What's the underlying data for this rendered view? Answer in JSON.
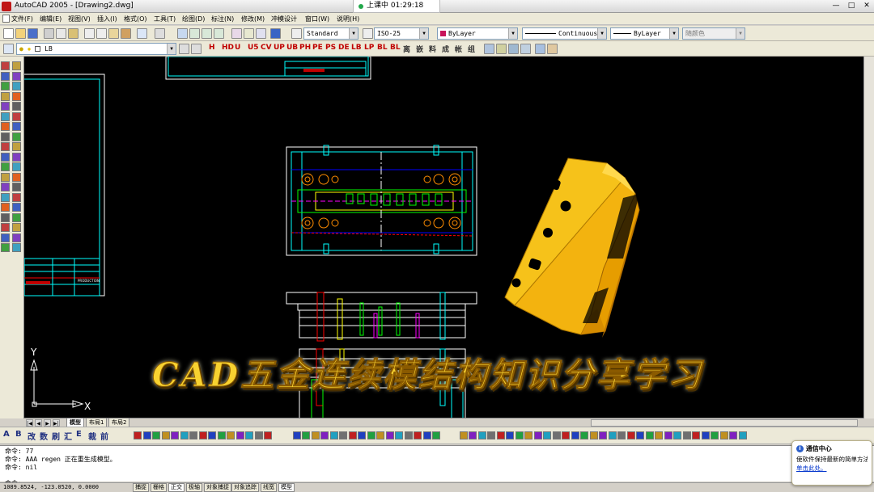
{
  "window": {
    "title": "AutoCAD 2005 - [Drawing2.dwg]",
    "meeting_status": "上课中 01:29:18",
    "min_label": "—",
    "max_label": "□",
    "close_label": "✕"
  },
  "menu": {
    "items": [
      "文件(F)",
      "编辑(E)",
      "视图(V)",
      "插入(I)",
      "格式(O)",
      "工具(T)",
      "绘图(D)",
      "标注(N)",
      "修改(M)",
      "冲模设计",
      "窗口(W)",
      "说明(H)"
    ]
  },
  "toolbar1": {
    "text_style": "Standard",
    "dim_style": "ISO-25",
    "layer_color": "ByLayer",
    "linetype": "Continuous",
    "lineweight": "ByLayer",
    "plot_style": "随颜色",
    "dropdown_arrow": "▼"
  },
  "toolbar2": {
    "layer": "LB",
    "mold_tools": [
      "H",
      "HD",
      "U",
      "U5",
      "CV",
      "UP",
      "UB",
      "PH",
      "PE",
      "PS",
      "DE",
      "LB",
      "LP",
      "BL",
      "BL",
      "离",
      "嵌",
      "料",
      "成",
      "帐",
      "组"
    ]
  },
  "tabs": {
    "items": [
      "模型",
      "布局1",
      "布局2"
    ],
    "nav": [
      "|◀",
      "◀",
      "▶",
      "▶|"
    ]
  },
  "bottom_toolbar": {
    "labels": [
      "A",
      "B",
      "改",
      "数",
      "刷",
      "汇",
      "E",
      "裁",
      "前"
    ]
  },
  "cad_overlay": {
    "title_block_label": "PRODUCTION",
    "ucs_y": "Y",
    "ucs_x": "X"
  },
  "banner": {
    "text": "CAD五金连续模结构知识分享学习"
  },
  "command": {
    "lines": [
      "命令: 77",
      "命令: AAA regen 正在重生成模型。",
      "命令: nil",
      "",
      "命令:"
    ]
  },
  "status": {
    "coords": "1089.8524, -123.0520, 0.0000",
    "buttons": [
      "捕捉",
      "栅格",
      "正交",
      "极轴",
      "对象捕捉",
      "对象追踪",
      "线宽",
      "模型"
    ],
    "active": [
      "正交",
      "模型"
    ]
  },
  "notification": {
    "title": "通信中心",
    "body": "使软件保持最新的简单方法",
    "link": "单击此处。",
    "icon": "i"
  },
  "colors": {
    "canvas": "#000000",
    "cad_cyan": "#00ffff",
    "cad_green": "#00ff00",
    "cad_red": "#ff0000",
    "cad_yellow": "#ffff00",
    "cad_magenta": "#ff00ff",
    "part_gold": "#f6c21a",
    "banner_gold": "#f8d230"
  },
  "icons": {
    "title": "autocad-logo-icon",
    "save": "save-icon",
    "open": "open-icon",
    "print": "print-icon",
    "undo": "undo-icon",
    "zoom": "zoom-icon",
    "help": "help-icon"
  }
}
